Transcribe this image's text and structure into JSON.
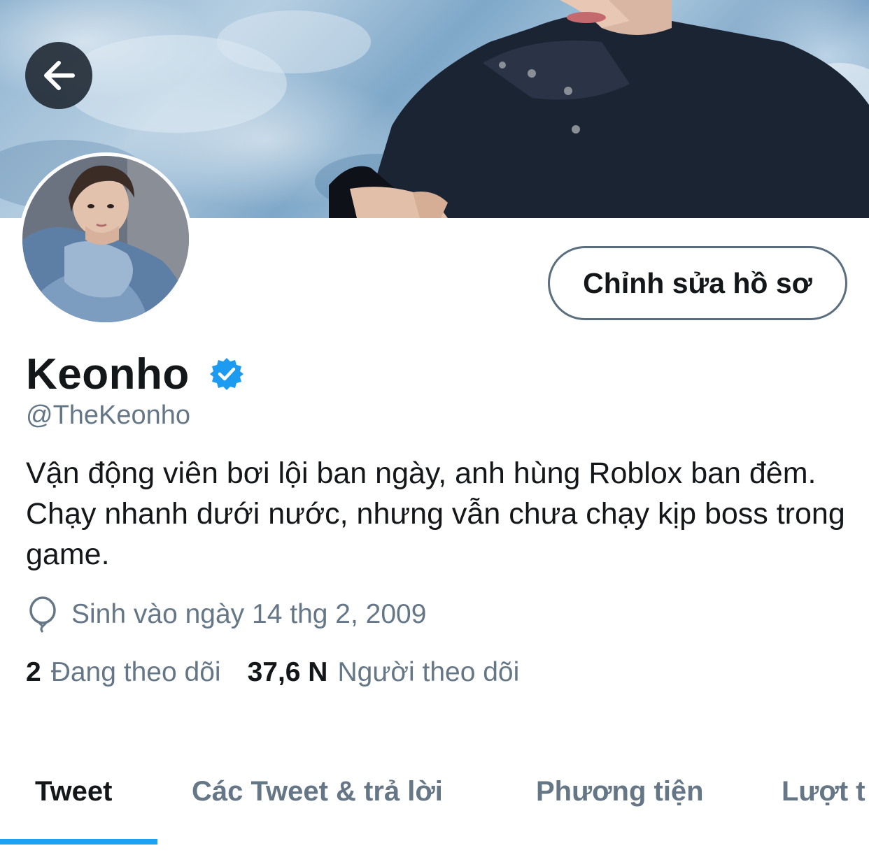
{
  "header": {
    "back_icon": "arrow-left-icon",
    "banner_colors": [
      "#8fb3d0",
      "#6f99bf",
      "#c5dbea"
    ]
  },
  "profile": {
    "display_name": "Keonho",
    "verified_icon": "verified-badge-icon",
    "verified_color": "#1d9bf0",
    "handle": "@TheKeonho",
    "edit_button_label": "Chỉnh sửa hồ sơ",
    "bio": "Vận động viên bơi lội ban ngày, anh hùng Roblox ban đêm. Chạy nhanh dưới nước, nhưng vẫn chưa chạy kịp boss trong game.",
    "birth_icon": "balloon-icon",
    "birth_text": "Sinh vào ngày 14 thg 2, 2009"
  },
  "stats": {
    "following_count": "2",
    "following_label": "Đang theo dõi",
    "followers_count": "37,6 N",
    "followers_label": "Người theo dõi"
  },
  "tabs": [
    {
      "label": "Tweet",
      "active": true
    },
    {
      "label": "Các Tweet & trả lời",
      "active": false
    },
    {
      "label": "Phương tiện",
      "active": false
    },
    {
      "label": "Lượt t",
      "active": false
    }
  ],
  "colors": {
    "accent": "#1da1f2",
    "text_primary": "#14171a",
    "text_secondary": "#657786"
  }
}
